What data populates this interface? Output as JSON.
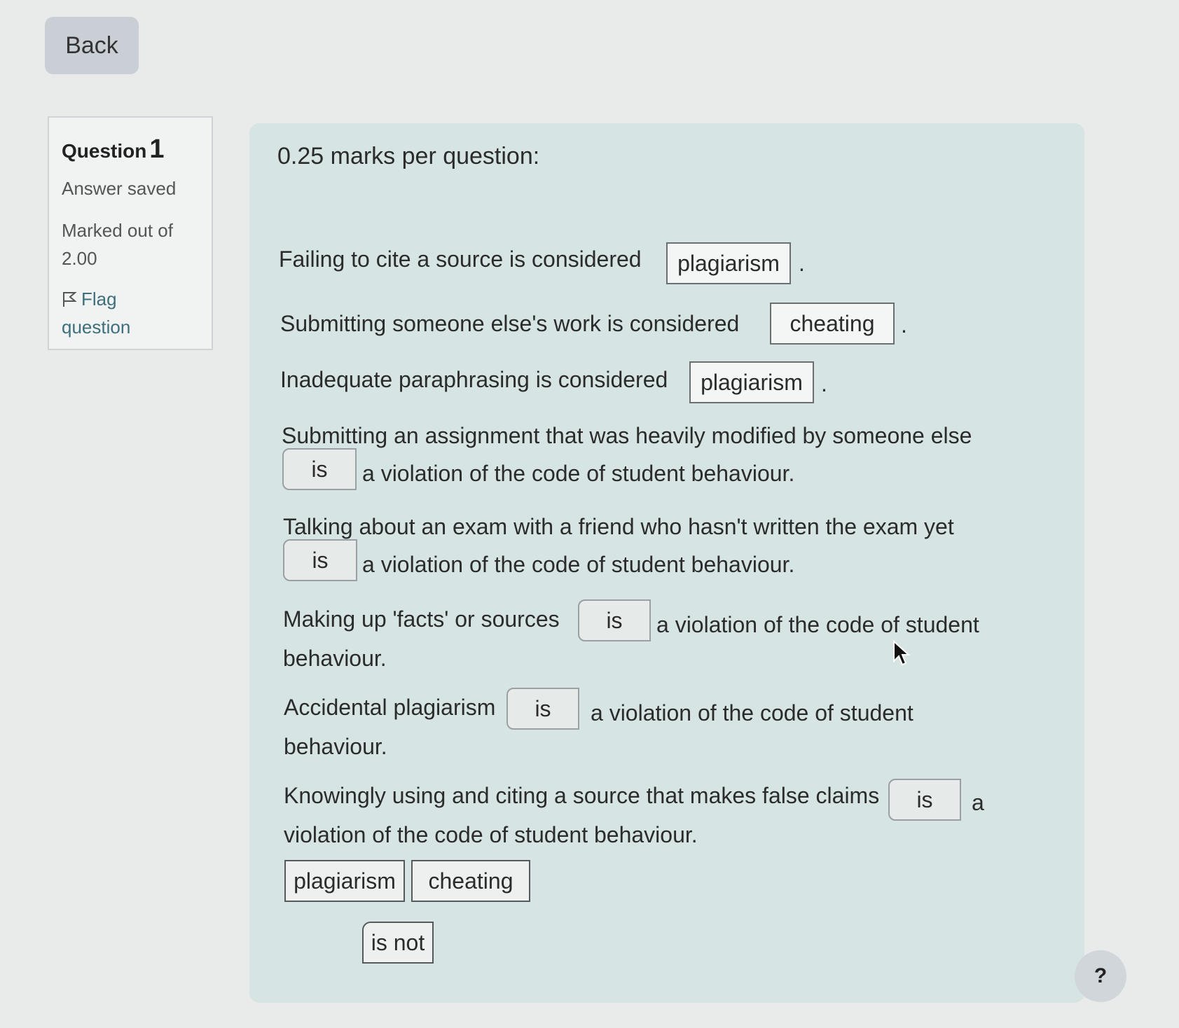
{
  "nav": {
    "back_label": "Back"
  },
  "question_info": {
    "title": "Question",
    "number": "1",
    "status": "Answer saved",
    "marked_line1": "Marked out of",
    "marked_line2": "2.00",
    "flag_line1": "Flag",
    "flag_line2": "question"
  },
  "question": {
    "intro": "0.25 marks per question:",
    "items": [
      {
        "text": "Failing to cite a source is considered",
        "answer": "plagiarism",
        "period": "."
      },
      {
        "text": "Submitting someone else's work is considered",
        "answer": "cheating",
        "period": "."
      },
      {
        "text": "Inadequate paraphrasing is considered",
        "answer": "plagiarism",
        "period": "."
      },
      {
        "text": "Submitting an assignment that was heavily modified by someone else",
        "answer": "is",
        "after": "a violation of the code of student behaviour."
      },
      {
        "text": "Talking about an exam with a friend who hasn't written the exam yet",
        "answer": "is",
        "after": "a violation of the code of student behaviour."
      },
      {
        "text": "Making up 'facts' or sources",
        "answer": "is",
        "after": "a violation of the code of student",
        "after2": "behaviour."
      },
      {
        "text": "Accidental plagiarism",
        "answer": "is",
        "after": "a violation of the code of student",
        "after2": "behaviour."
      },
      {
        "text": "Knowingly using and citing a source that makes false claims",
        "answer": "is",
        "after": "a",
        "after2": "violation of the code of student behaviour."
      }
    ],
    "choices": [
      "plagiarism",
      "cheating",
      "is not"
    ]
  },
  "help": {
    "label": "?"
  }
}
